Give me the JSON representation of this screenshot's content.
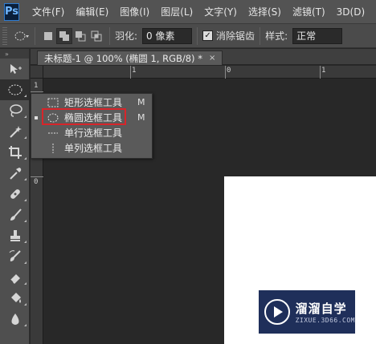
{
  "app": {
    "logo": "Ps"
  },
  "menubar": {
    "items": [
      "文件(F)",
      "编辑(E)",
      "图像(I)",
      "图层(L)",
      "文字(Y)",
      "选择(S)",
      "滤镜(T)",
      "3D(D)"
    ]
  },
  "options": {
    "feather_label": "羽化:",
    "feather_value": "0 像素",
    "antialias_label": "消除锯齿",
    "antialias_checked": true,
    "style_label": "样式:",
    "style_value": "正常"
  },
  "toolbox": {
    "header": "»",
    "tools": [
      "move-tool",
      "ellipse-marquee-tool",
      "lasso-tool",
      "magic-wand-tool",
      "crop-tool",
      "eyedropper-tool",
      "healing-brush-tool",
      "brush-tool",
      "clone-stamp-tool",
      "history-brush-tool",
      "eraser-tool",
      "paint-bucket-tool",
      "blur-tool"
    ]
  },
  "document": {
    "tab_title": "未标题-1 @ 100% (椭圆 1, RGB/8) *",
    "close_glyph": "×"
  },
  "rulers": {
    "horizontal_labels": [
      "1",
      "0",
      "1"
    ],
    "vertical_labels": [
      "1",
      "0"
    ]
  },
  "flyout": {
    "items": [
      {
        "label": "矩形选框工具",
        "shortcut": "M",
        "icon": "rect-marquee-icon",
        "active": false
      },
      {
        "label": "椭圆选框工具",
        "shortcut": "M",
        "icon": "ellipse-marquee-icon",
        "active": true
      },
      {
        "label": "单行选框工具",
        "shortcut": "",
        "icon": "single-row-marquee-icon",
        "active": false
      },
      {
        "label": "单列选框工具",
        "shortcut": "",
        "icon": "single-column-marquee-icon",
        "active": false
      }
    ]
  },
  "watermark": {
    "title": "溜溜自学",
    "subtitle": "ZIXUE.3D66.COM"
  },
  "colors": {
    "highlight": "#d8252a",
    "canvas": "#282828",
    "page": "#ffffff",
    "watermark_bg": "#1f2f5a"
  }
}
